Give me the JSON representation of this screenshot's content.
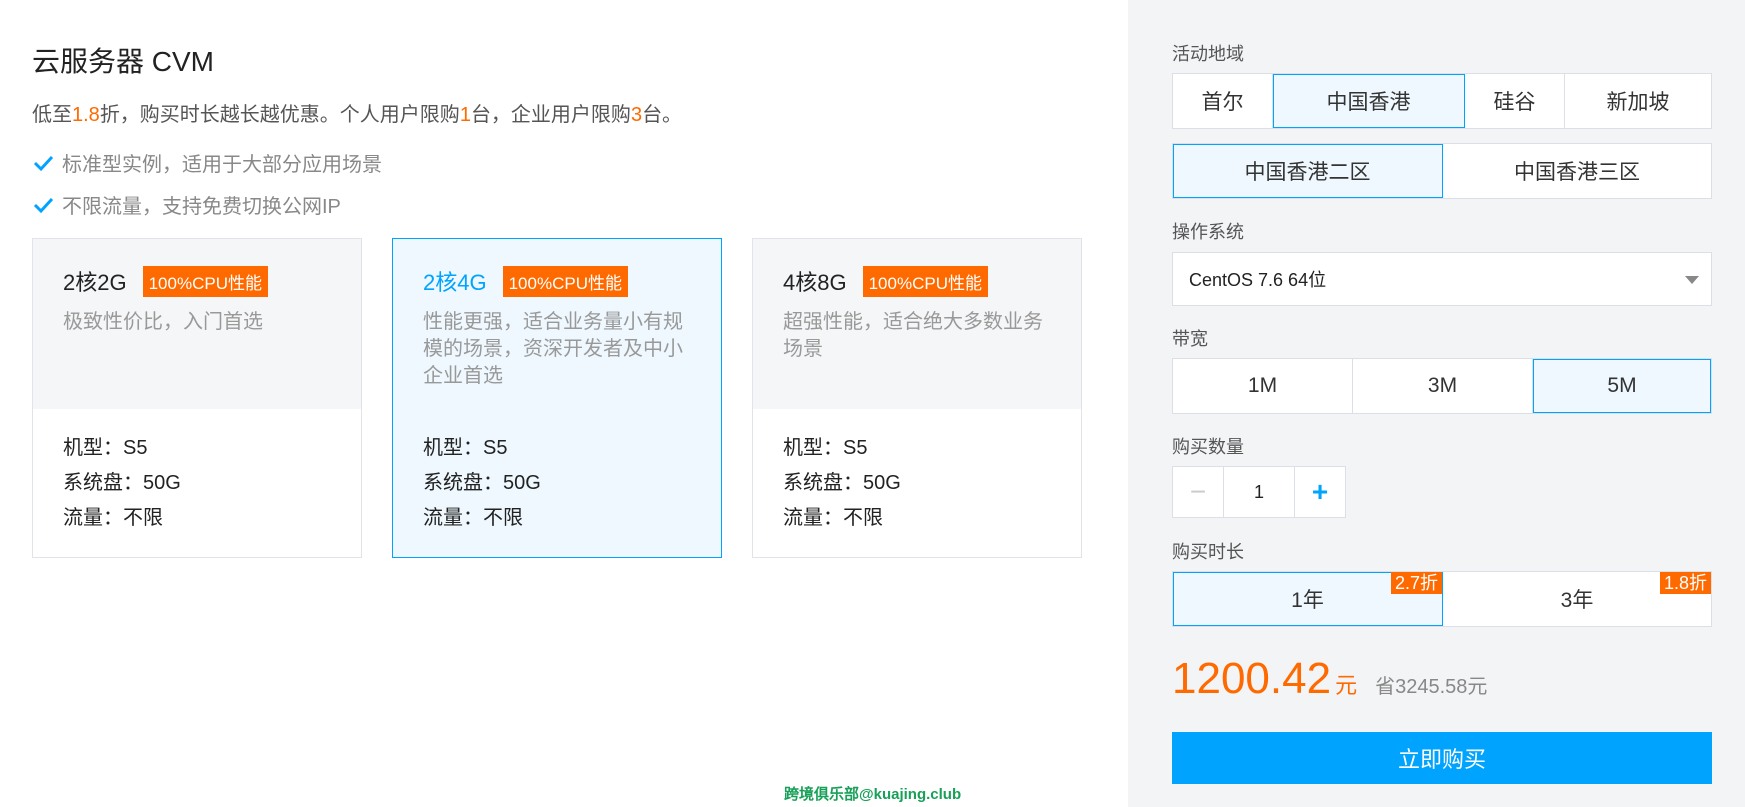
{
  "product": {
    "title": "云服务器 CVM",
    "promo": {
      "p1": "低至",
      "discount": "1.8",
      "p2": "折，购买时长越长越优惠。个人用户限购",
      "personal_limit": "1",
      "p3": "台，企业用户限购",
      "enterprise_limit": "3",
      "p4": "台。"
    },
    "features": [
      "标准型实例，适用于大部分应用场景",
      "不限流量，支持免费切换公网IP"
    ]
  },
  "cards": [
    {
      "name": "2核2G",
      "badge": "100%CPU性能",
      "desc": "极致性价比，入门首选",
      "specs": [
        "机型：S5",
        "系统盘：50G",
        "流量：不限"
      ],
      "selected": false
    },
    {
      "name": "2核4G",
      "badge": "100%CPU性能",
      "desc": "性能更强，适合业务量小有规模的场景，资深开发者及中小企业首选",
      "specs": [
        "机型：S5",
        "系统盘：50G",
        "流量：不限"
      ],
      "selected": true
    },
    {
      "name": "4核8G",
      "badge": "100%CPU性能",
      "desc": "超强性能，适合绝大多数业务场景",
      "specs": [
        "机型：S5",
        "系统盘：50G",
        "流量：不限"
      ],
      "selected": false
    }
  ],
  "watermark": "跨境俱乐部@kuajing.club",
  "config": {
    "region_label": "活动地域",
    "regions": [
      "首尔",
      "中国香港",
      "硅谷",
      "新加坡"
    ],
    "region_selected": "中国香港",
    "zones": [
      "中国香港二区",
      "中国香港三区"
    ],
    "zone_selected": "中国香港二区",
    "os_label": "操作系统",
    "os_value": "CentOS 7.6 64位",
    "bandwidth_label": "带宽",
    "bandwidths": [
      "1M",
      "3M",
      "5M"
    ],
    "bandwidth_selected": "5M",
    "quantity_label": "购买数量",
    "quantity_minus": "−",
    "quantity": "1",
    "quantity_plus": "+",
    "duration_label": "购买时长",
    "durations": [
      {
        "label": "1年",
        "discount": "2.7折",
        "selected": true
      },
      {
        "label": "3年",
        "discount": "1.8折",
        "selected": false
      }
    ],
    "price": "1200.42",
    "price_unit": "元",
    "savings": "省3245.58元",
    "buy_label": "立即购买"
  },
  "colors": {
    "accent": "#00a4ff",
    "orange": "#ff6a00",
    "sidebar_bg": "#f3f4f6",
    "watermark": "#18a058"
  }
}
